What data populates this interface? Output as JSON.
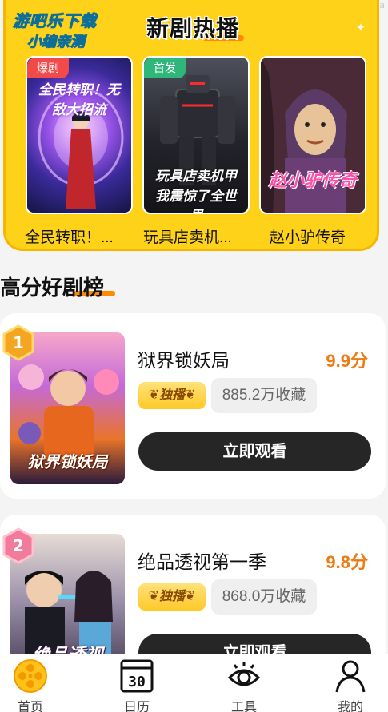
{
  "watermark": {
    "line1": "游吧乐下载",
    "line2": "小编亲测",
    "corner_id": "Uyousba"
  },
  "hot": {
    "title": "新剧热播",
    "items": [
      {
        "name": "全民转职！...",
        "tag": "爆剧",
        "tag_color": "#f04a4a",
        "art_text": "全民转职！无敌大招流"
      },
      {
        "name": "玩具店卖机...",
        "tag": "首发",
        "tag_color": "#2fb67a",
        "art_text": "玩具店卖机甲我震惊了全世界"
      },
      {
        "name": "赵小驴传奇",
        "tag": "",
        "tag_color": "",
        "art_text": "赵小驴传奇"
      }
    ]
  },
  "ranking": {
    "title": "高分好剧榜",
    "items": [
      {
        "rank": "1",
        "name": "狱界锁妖局",
        "score": "9.9分",
        "exclusive": "独播",
        "collect": "885.2万收藏",
        "button": "立即观看",
        "art_text": "狱界锁妖局"
      },
      {
        "rank": "2",
        "name": "绝品透视第一季",
        "score": "9.8分",
        "exclusive": "独播",
        "collect": "868.0万收藏",
        "button": "立即观看",
        "art_text": "绝品透视"
      }
    ]
  },
  "tabbar": {
    "items": [
      {
        "label": "首页",
        "icon": "film-reel-icon",
        "active": true
      },
      {
        "label": "日历",
        "icon": "calendar-icon",
        "calendar_day": "30"
      },
      {
        "label": "工具",
        "icon": "eye-icon"
      },
      {
        "label": "我的",
        "icon": "user-icon"
      }
    ]
  },
  "colors": {
    "accent": "#ffd21a",
    "score": "#ee7a12",
    "button": "#262626"
  }
}
